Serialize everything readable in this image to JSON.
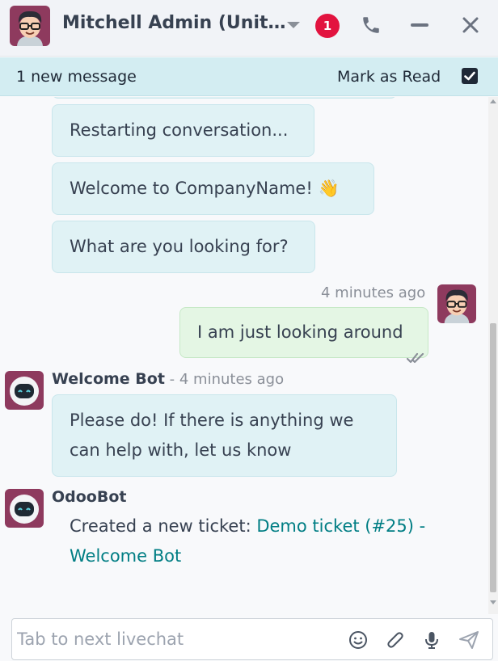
{
  "header": {
    "name": "Mitchell Admin (Unit…",
    "badge": "1"
  },
  "new_message_bar": {
    "text": "1 new message",
    "mark_read_label": "Mark as Read"
  },
  "messages": [
    {
      "text": "Restarting conversation..."
    },
    {
      "text": "Welcome to CompanyName! 👋"
    },
    {
      "text": "What are you looking for?"
    },
    {
      "time": "4 minutes ago",
      "text": "I am just looking around"
    },
    {
      "author": "Welcome Bot",
      "time": " - 4 minutes ago",
      "line1": "Please do! If there is anything we",
      "line2": "can help with, let us know"
    },
    {
      "author": "OdooBot",
      "prefix": "Created a new ticket: ",
      "link_part1": "Demo ticket (#25) -",
      "link_part2": "Welcome Bot"
    }
  ],
  "composer": {
    "placeholder": "Tab to next livechat"
  },
  "colors": {
    "accent": "#017e84",
    "badge": "#e2133f",
    "bot_bubble": "#e0f2f5",
    "user_bubble": "#e4f6e4"
  },
  "icons": [
    "avatar",
    "chevron-down-icon",
    "phone-icon",
    "minimize-icon",
    "close-icon",
    "checkbox-checked-icon",
    "double-check-icon",
    "emoji-icon",
    "paperclip-icon",
    "microphone-icon",
    "send-icon"
  ]
}
